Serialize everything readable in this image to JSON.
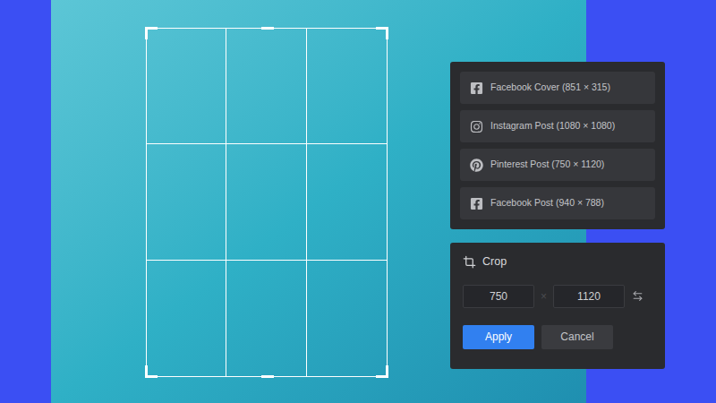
{
  "presets": [
    {
      "kind": "facebook",
      "label": "Facebook Cover (851 × 315)"
    },
    {
      "kind": "instagram",
      "label": "Instagram Post (1080 × 1080)"
    },
    {
      "kind": "pinterest",
      "label": "Pinterest Post (750 × 1120)"
    },
    {
      "kind": "facebook",
      "label": "Facebook Post (940 × 788)"
    }
  ],
  "crop": {
    "title": "Crop",
    "width": "750",
    "separator": "×",
    "height": "1120",
    "buttons": [
      {
        "label": "Apply",
        "primary": true
      },
      {
        "label": "Cancel",
        "primary": false
      }
    ]
  }
}
